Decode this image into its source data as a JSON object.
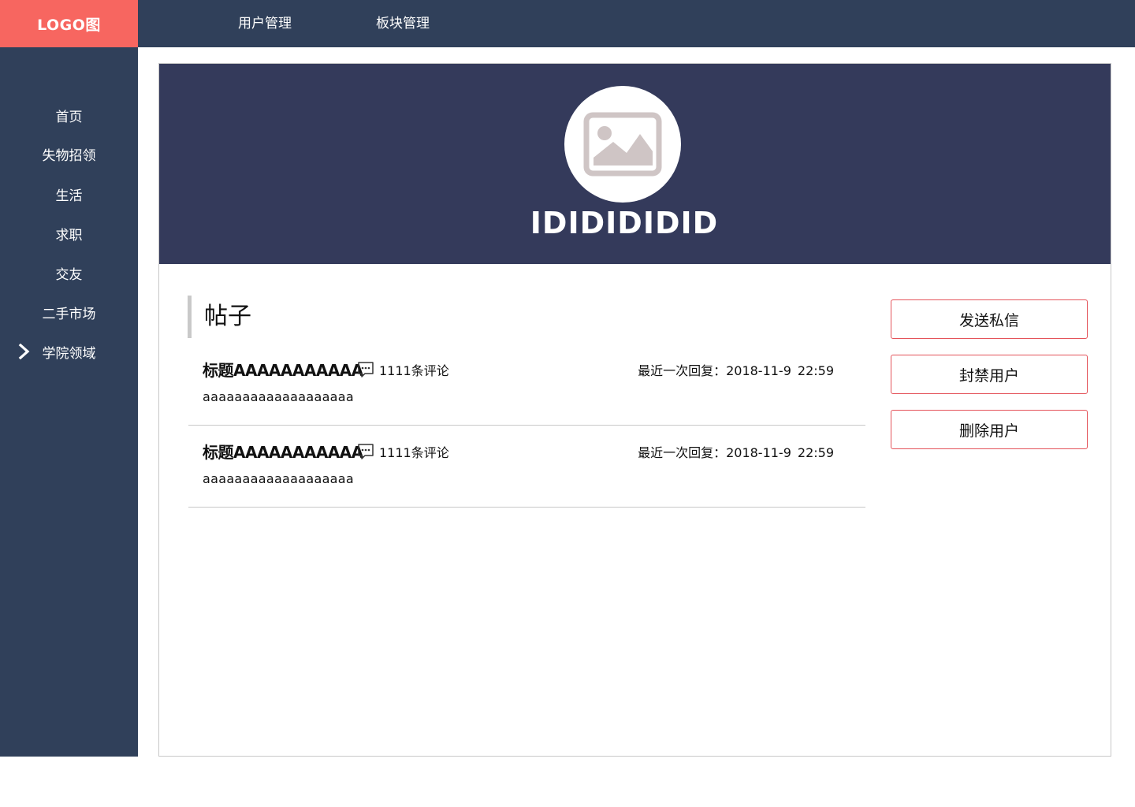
{
  "logo": {
    "text": "LOGO图"
  },
  "topnav": [
    {
      "label": "用户管理"
    },
    {
      "label": "板块管理"
    }
  ],
  "sidebar": {
    "items": [
      {
        "label": "首页"
      },
      {
        "label": "失物招领"
      },
      {
        "label": "生活"
      },
      {
        "label": "求职"
      },
      {
        "label": "交友"
      },
      {
        "label": "二手市场"
      },
      {
        "label": "学院领域",
        "expandable": true,
        "icon": "chevron-right-icon"
      }
    ]
  },
  "profile": {
    "avatar_icon": "image-placeholder-icon",
    "username": "IDIDIDIDID"
  },
  "posts_section": {
    "title": "帖子",
    "posts": [
      {
        "title": "标题AAAAAAAAAAA",
        "comment_icon": "comment-icon",
        "comments": "1111条评论",
        "reply_label": "最近一次回复：2018-11-9",
        "reply_time": "22:59",
        "body": "aaaaaaaaaaaaaaaaaaa"
      },
      {
        "title": "标题AAAAAAAAAAA",
        "comment_icon": "comment-icon",
        "comments": "1111条评论",
        "reply_label": "最近一次回复：2018-11-9",
        "reply_time": "22:59",
        "body": "aaaaaaaaaaaaaaaaaaa"
      }
    ]
  },
  "actions": {
    "send_message": "发送私信",
    "ban_user": "封禁用户",
    "delete_user": "删除用户"
  },
  "colors": {
    "logo_bg": "#f76660",
    "nav_bg": "#30405a",
    "banner_bg": "#343a5b",
    "button_border": "#e4535a"
  }
}
